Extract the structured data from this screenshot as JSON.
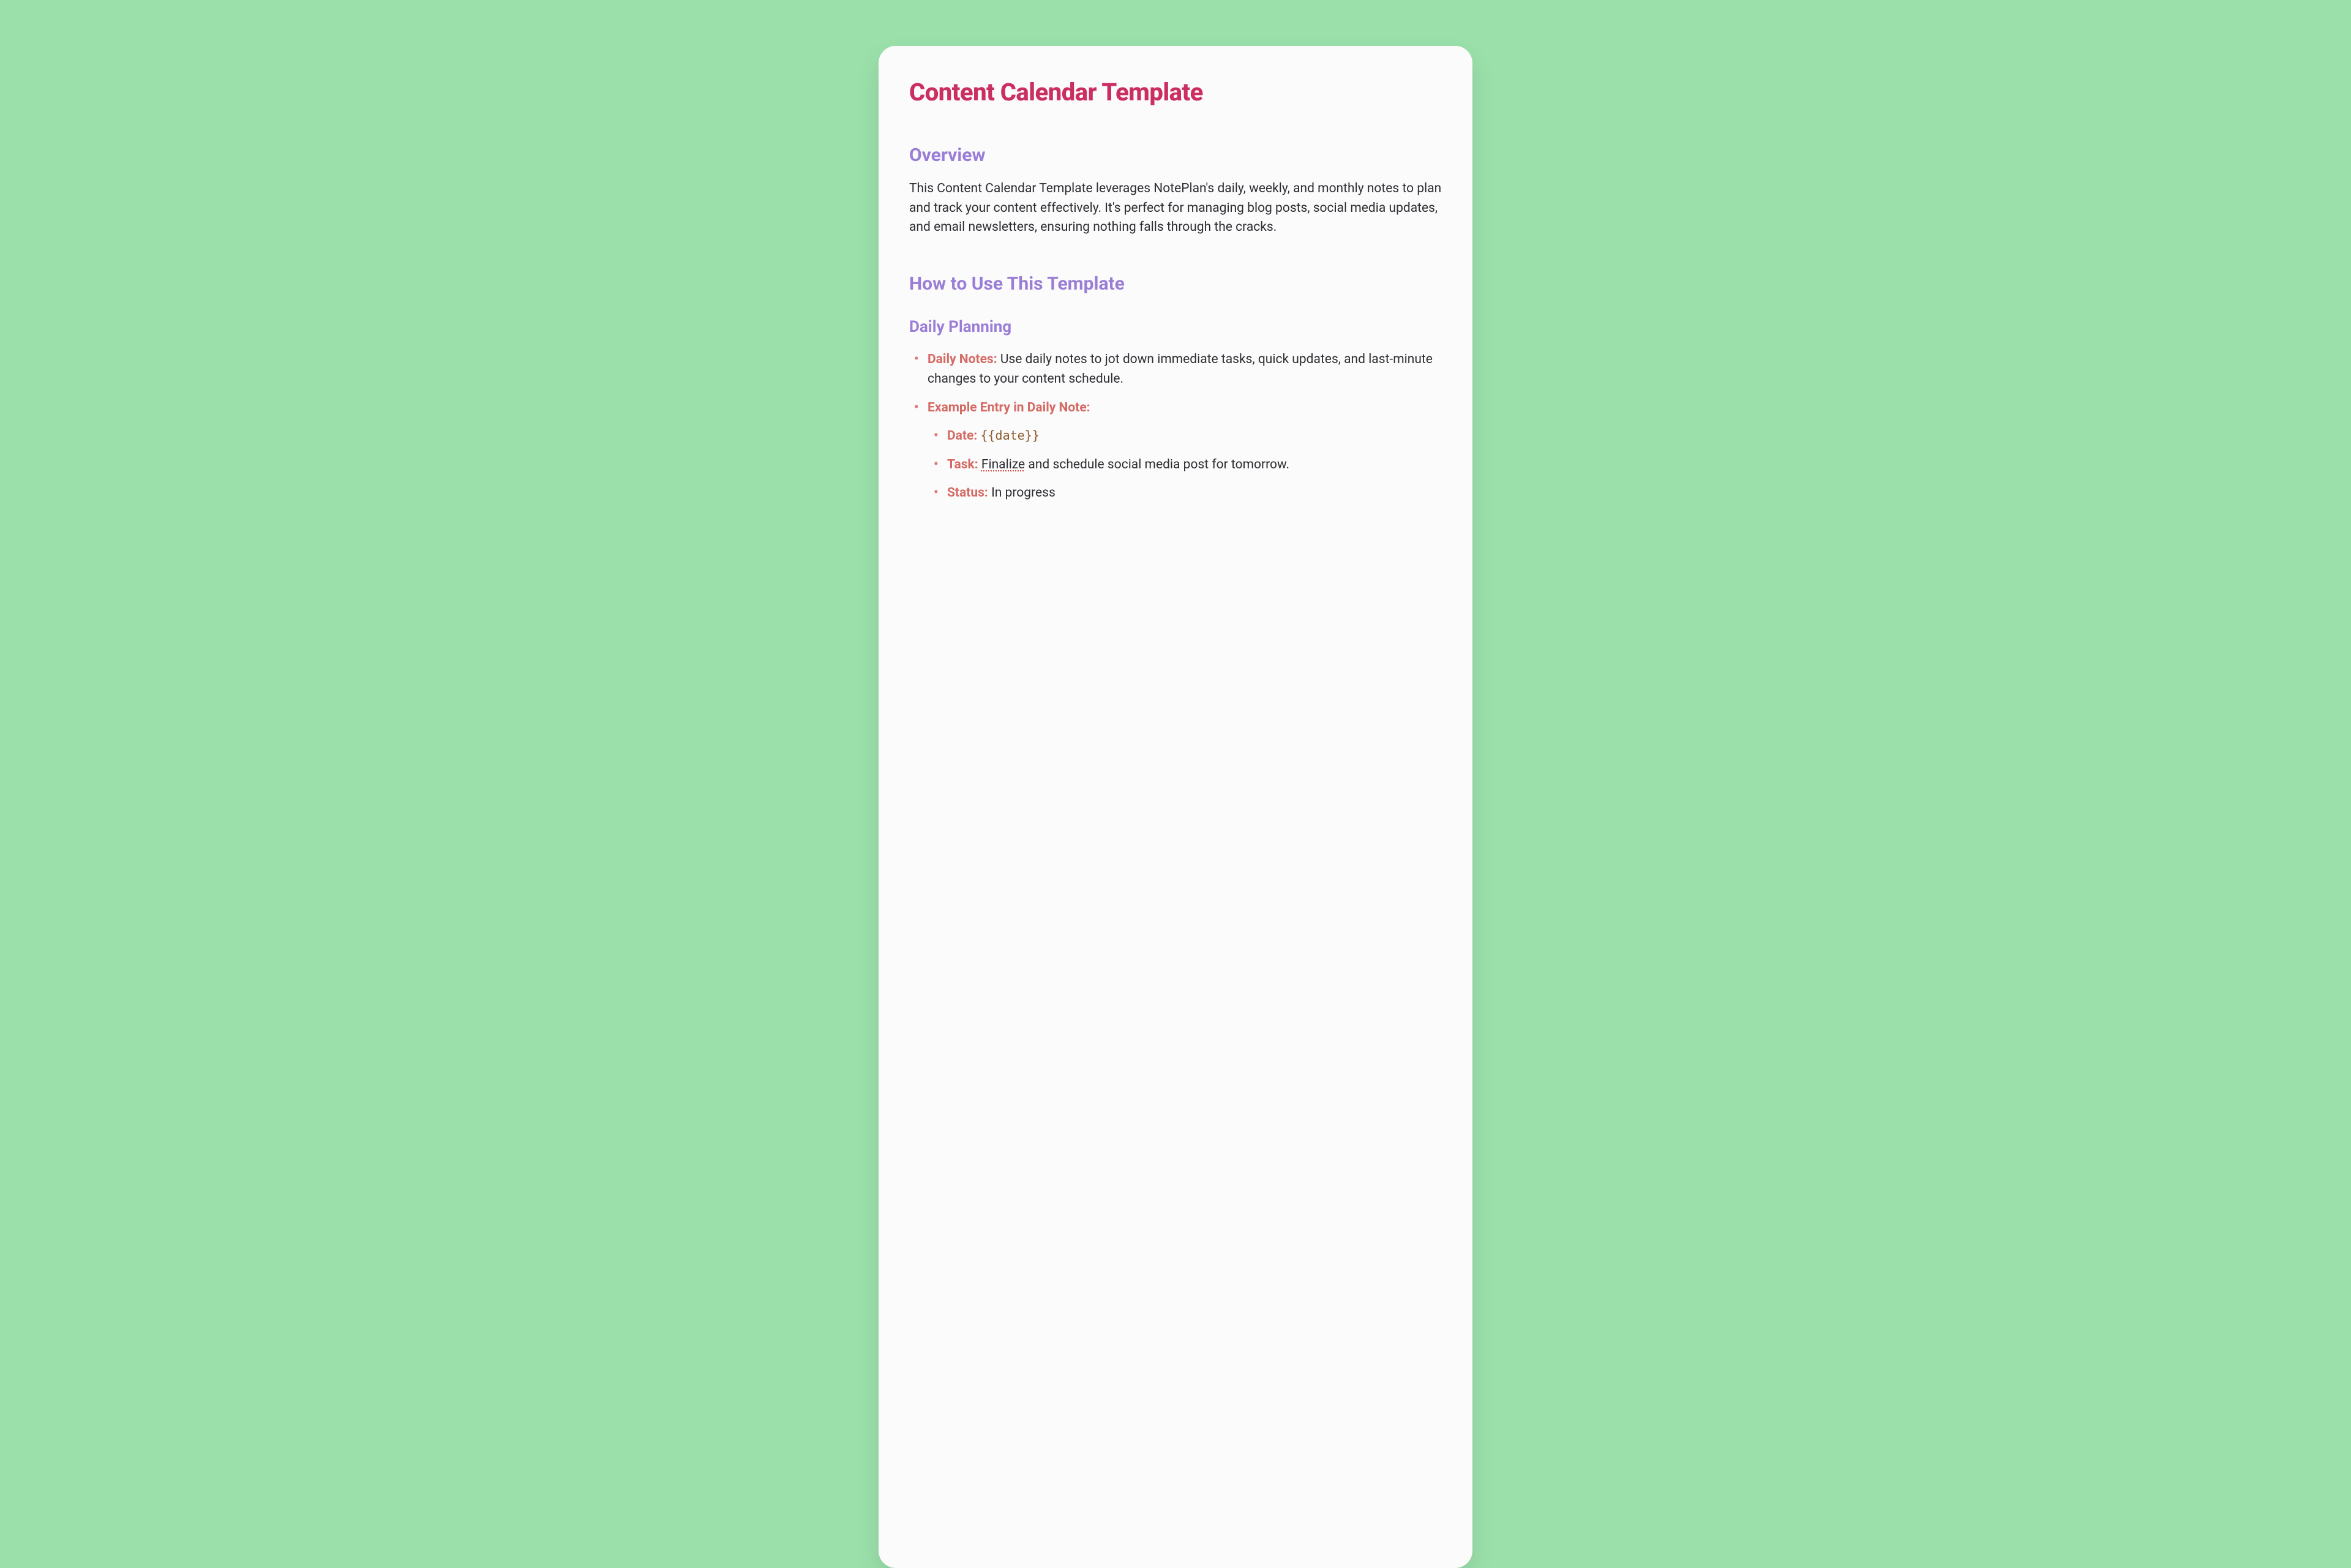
{
  "title": "Content Calendar Template",
  "overview": {
    "heading": "Overview",
    "body": "This Content Calendar Template leverages NotePlan's daily, weekly, and monthly notes to plan and track your content effectively. It's perfect for managing blog posts, social media updates, and email newsletters, ensuring nothing falls through the cracks."
  },
  "howto": {
    "heading": "How to Use This Template"
  },
  "daily": {
    "heading": "Daily Planning",
    "item1": {
      "label": "Daily Notes:",
      "text": " Use daily notes to jot down immediate tasks, quick updates, and last-minute changes to your content schedule."
    },
    "item2": {
      "label": "Example Entry in Daily Note:"
    },
    "nested": {
      "date": {
        "label": "Date: ",
        "value": "{{date}}"
      },
      "task": {
        "label": "Task: ",
        "squiggle": "Finalize",
        "rest": " and schedule social media post for tomorrow."
      },
      "status": {
        "label": "Status: ",
        "value": "In progress"
      }
    }
  }
}
